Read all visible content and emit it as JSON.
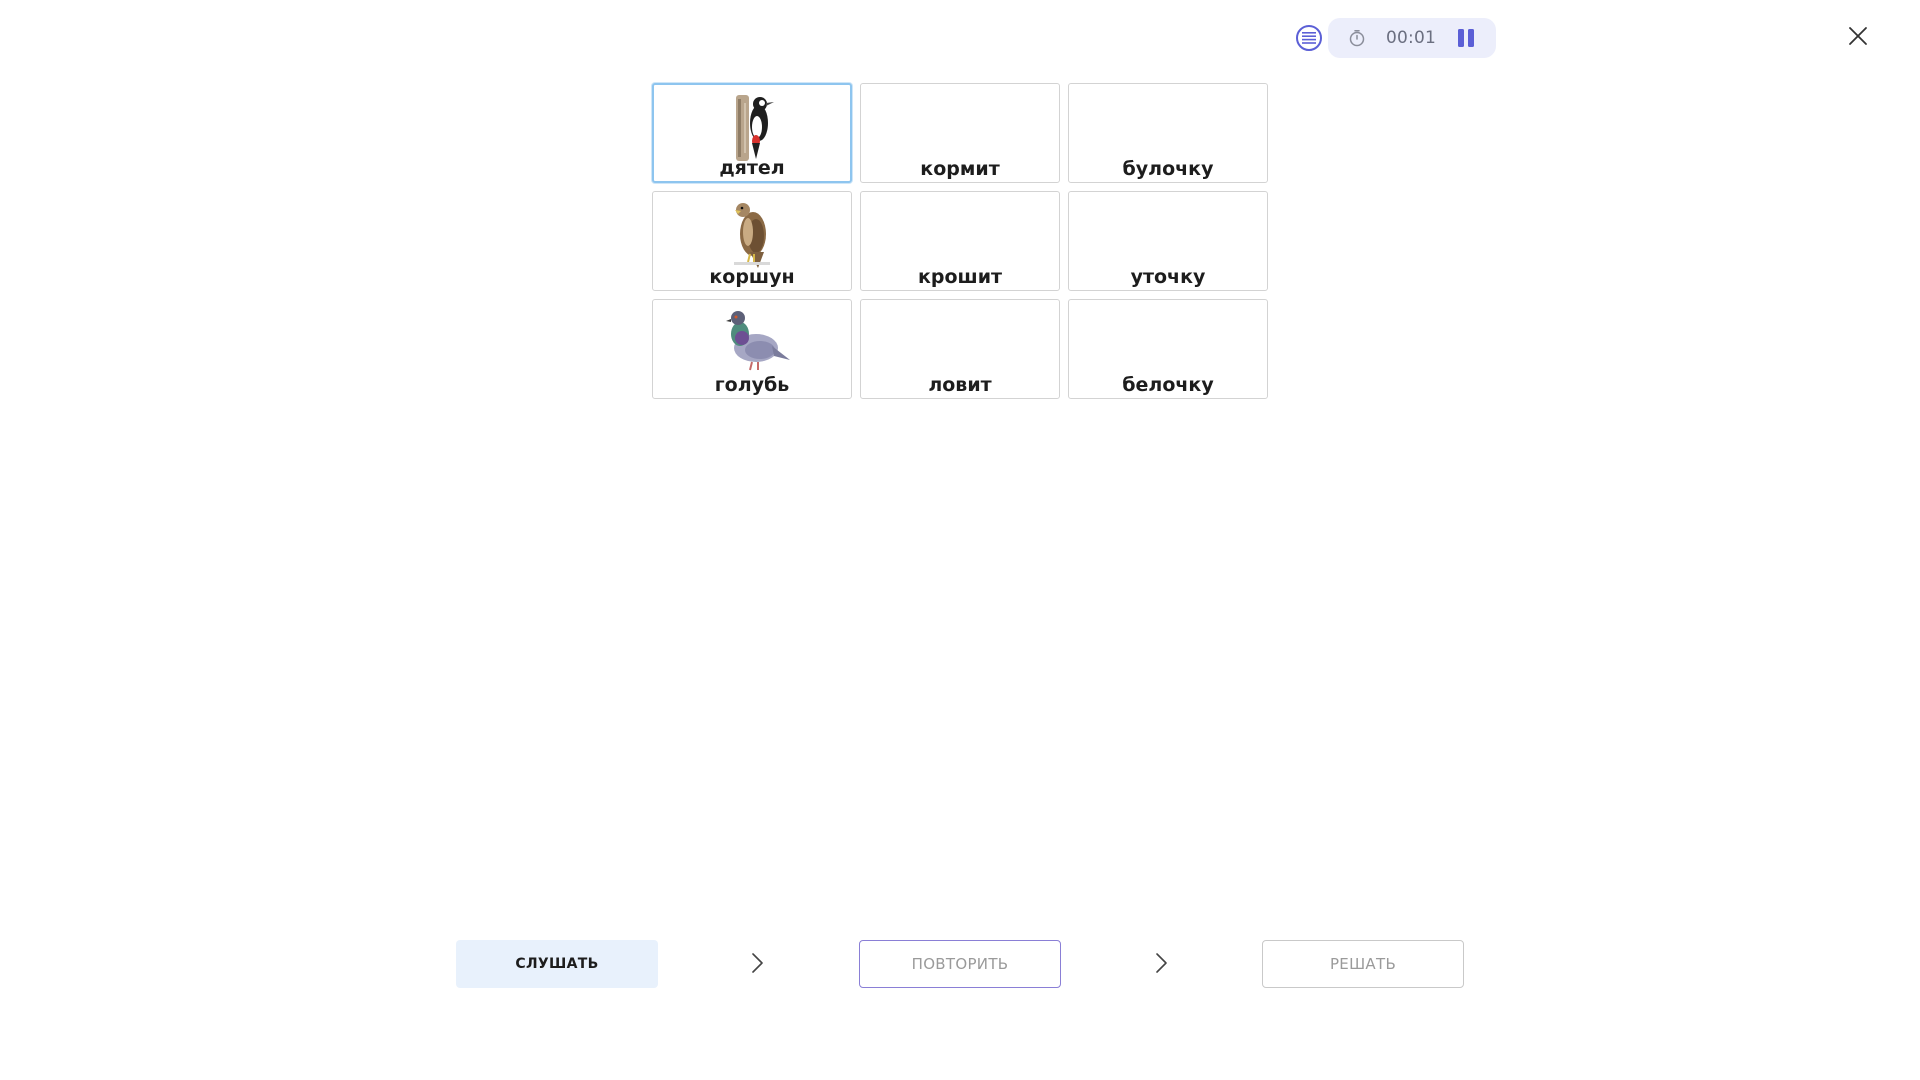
{
  "header": {
    "menu_icon": "list-icon",
    "timer_icon": "stopwatch-icon",
    "timer": "00:01",
    "pause_icon": "pause-icon",
    "close_icon": "close-icon",
    "accent_color": "#5b5fd6"
  },
  "grid": {
    "rows": [
      [
        {
          "label": "дятел",
          "image": "woodpecker-image",
          "selected": true
        },
        {
          "label": "кормит",
          "image": null,
          "selected": false
        },
        {
          "label": "булочку",
          "image": null,
          "selected": false
        }
      ],
      [
        {
          "label": "коршун",
          "image": "kite-bird-image",
          "selected": false
        },
        {
          "label": "крошит",
          "image": null,
          "selected": false
        },
        {
          "label": "уточку",
          "image": null,
          "selected": false
        }
      ],
      [
        {
          "label": "голубь",
          "image": "pigeon-image",
          "selected": false
        },
        {
          "label": "ловит",
          "image": null,
          "selected": false
        },
        {
          "label": "белочку",
          "image": null,
          "selected": false
        }
      ]
    ]
  },
  "footer": {
    "listen_label": "СЛУШАТЬ",
    "repeat_label": "ПОВТОРИТЬ",
    "solve_label": "РЕШАТЬ",
    "arrow_icon": "chevron-right-icon"
  }
}
